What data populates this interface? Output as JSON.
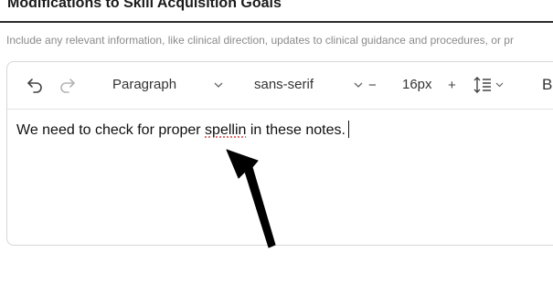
{
  "section": {
    "title": "Modifications to Skill Acquisition Goals",
    "help_text": "Include any relevant information, like clinical direction, updates to clinical guidance and procedures, or pr"
  },
  "toolbar": {
    "block_format": "Paragraph",
    "font_family": "sans-serif",
    "font_size": "16px",
    "minus_label": "−",
    "plus_label": "+",
    "bold_label": "B",
    "icons": [
      "undo-icon",
      "redo-icon",
      "chevron-down-icon",
      "line-height-icon"
    ]
  },
  "editor": {
    "text_before": "We need to check for proper ",
    "misspelled_word": "spellin",
    "text_after": " in these notes."
  },
  "colors": {
    "title_rule": "#2a2a2a",
    "spellcheck_underline": "#d04040",
    "annotation_arrow": "#000000"
  }
}
